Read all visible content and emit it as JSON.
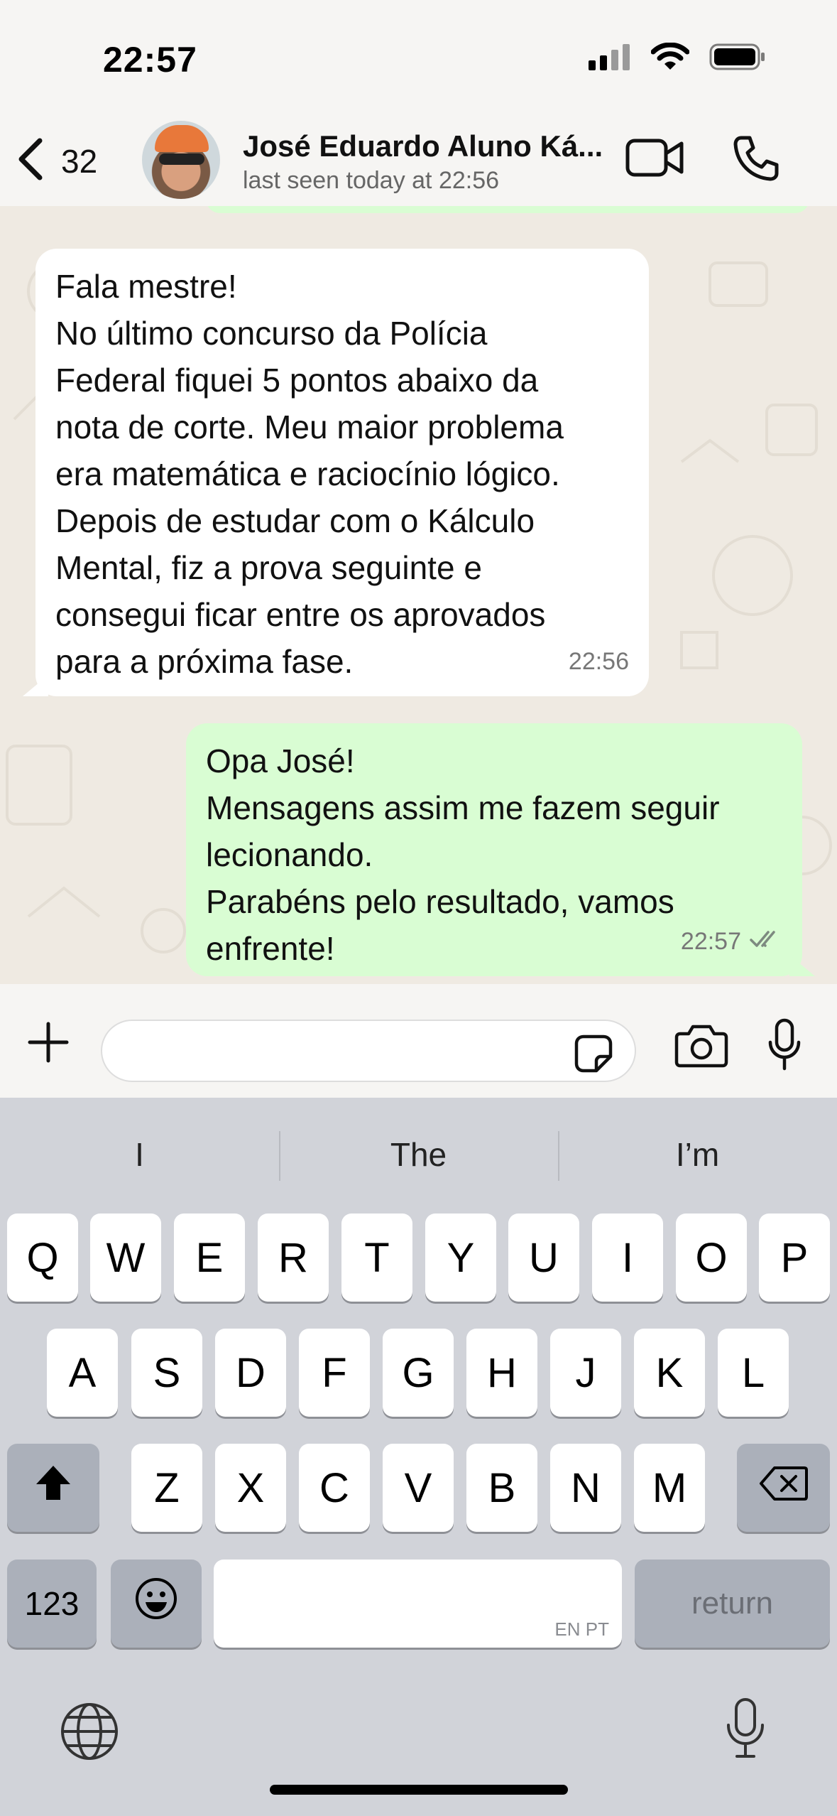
{
  "status_bar": {
    "time": "22:57"
  },
  "header": {
    "back_count": "32",
    "contact_name": "José Eduardo Aluno Ká...",
    "last_seen": "last seen today at 22:56"
  },
  "messages": [
    {
      "direction": "incoming",
      "lines": [
        "Fala mestre!",
        "No último concurso da Polícia",
        "Federal fiquei 5 pontos abaixo da",
        "nota de corte. Meu maior problema",
        "era matemática e raciocínio lógico.",
        "Depois de estudar com o Kálculo",
        "Mental, fiz a prova seguinte e",
        "consegui ficar entre os aprovados",
        "para a próxima fase."
      ],
      "time": "22:56"
    },
    {
      "direction": "outgoing",
      "lines": [
        "Opa José!",
        "Mensagens assim me fazem seguir",
        "lecionando.",
        "Parabéns pelo resultado, vamos",
        "enfrente!"
      ],
      "time": "22:57",
      "status": "read"
    }
  ],
  "input": {
    "placeholder": ""
  },
  "keyboard": {
    "suggestions": [
      "I",
      "The",
      "I’m"
    ],
    "row1": [
      "Q",
      "W",
      "E",
      "R",
      "T",
      "Y",
      "U",
      "I",
      "O",
      "P"
    ],
    "row2": [
      "A",
      "S",
      "D",
      "F",
      "G",
      "H",
      "J",
      "K",
      "L"
    ],
    "row3": [
      "Z",
      "X",
      "C",
      "V",
      "B",
      "N",
      "M"
    ],
    "numbers_label": "123",
    "space_hint": "EN PT",
    "return_label": "return"
  },
  "colors": {
    "outgoing_bubble": "#d9fdd3",
    "incoming_bubble": "#ffffff",
    "chat_background": "#efeae2",
    "keyboard_background": "#d1d3d9"
  }
}
